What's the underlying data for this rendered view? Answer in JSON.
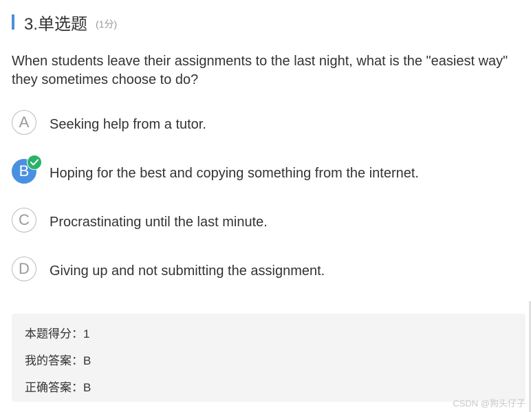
{
  "question": {
    "title": "3.单选题",
    "score": "(1分)",
    "text": "When students leave their assignments to the last night, what is the \"easiest way\" they sometimes choose to do?"
  },
  "options": [
    {
      "letter": "A",
      "text": "Seeking help from a tutor.",
      "selected": false
    },
    {
      "letter": "B",
      "text": "Hoping for the best and copying something from the internet.",
      "selected": true
    },
    {
      "letter": "C",
      "text": "Procrastinating until the last minute.",
      "selected": false
    },
    {
      "letter": "D",
      "text": "Giving up and not submitting the assignment.",
      "selected": false
    }
  ],
  "result": {
    "score_line": "本题得分：1",
    "my_answer_line": "我的答案：B",
    "correct_answer_line": "正确答案：B"
  },
  "watermark": "CSDN @狗头仔子",
  "colors": {
    "accent": "#4a90e2",
    "check": "#29b36a"
  },
  "icons": {
    "correct": "check-circle-icon"
  }
}
